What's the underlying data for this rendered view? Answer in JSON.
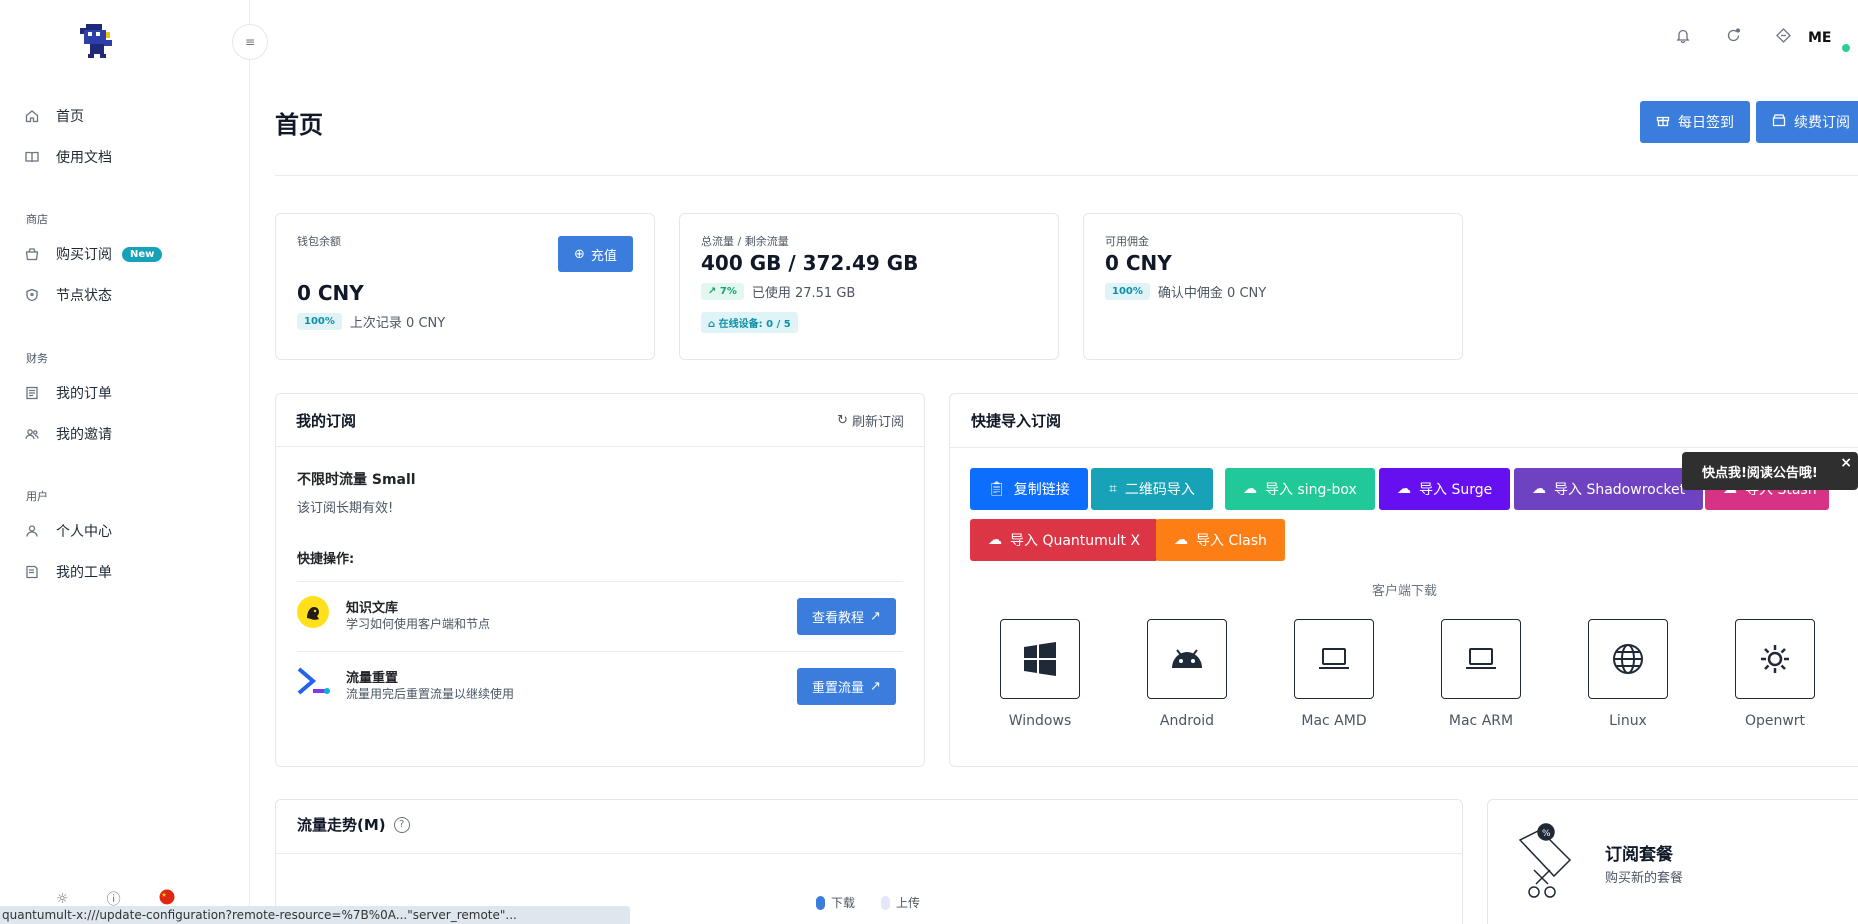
{
  "sidebar": {
    "items_main": [
      {
        "label": "首页",
        "icon": "home-icon"
      },
      {
        "label": "使用文档",
        "icon": "book-icon"
      }
    ],
    "section_shop": "商店",
    "items_shop": [
      {
        "label": "购买订阅",
        "icon": "shop-icon",
        "badge": "New"
      },
      {
        "label": "节点状态",
        "icon": "shield-icon"
      }
    ],
    "section_finance": "财务",
    "items_finance": [
      {
        "label": "我的订单",
        "icon": "receipt-icon"
      },
      {
        "label": "我的邀请",
        "icon": "users-icon"
      }
    ],
    "section_user": "用户",
    "items_user": [
      {
        "label": "个人中心",
        "icon": "user-icon"
      },
      {
        "label": "我的工单",
        "icon": "ticket-icon"
      }
    ]
  },
  "topbar": {
    "avatar_initials": "ME"
  },
  "page": {
    "title": "首页",
    "checkin_label": "每日签到",
    "renew_label": "续费订阅"
  },
  "stats": {
    "wallet": {
      "label": "钱包余额",
      "recharge_label": "充值",
      "value": "0 CNY",
      "pill": "100%",
      "note": "上次记录 0 CNY"
    },
    "traffic": {
      "label": "总流量 / 剩余流量",
      "value": "400 GB / 372.49 GB",
      "pill": "7%",
      "note": "已使用 27.51 GB",
      "devices": "在线设备: 0 / 5"
    },
    "commission": {
      "label": "可用佣金",
      "value": "0 CNY",
      "pill": "100%",
      "note": "确认中佣金 0 CNY"
    }
  },
  "subscription": {
    "title": "我的订阅",
    "refresh_label": "刷新订阅",
    "plan_name": "不限时流量 Small",
    "plan_note": "该订阅长期有效!",
    "quick_ops": "快捷操作:",
    "ops": [
      {
        "title": "知识文库",
        "desc": "学习如何使用客户端和节点",
        "button": "查看教程"
      },
      {
        "title": "流量重置",
        "desc": "流量用完后重置流量以继续使用",
        "button": "重置流量"
      }
    ]
  },
  "quick_import": {
    "title": "快捷导入订阅",
    "buttons": [
      {
        "label": "复制链接",
        "color": "#0d6efd"
      },
      {
        "label": "二维码导入",
        "color": "#17a2b8"
      },
      {
        "label": "导入 sing-box",
        "color": "#20c997"
      },
      {
        "label": "导入 Surge",
        "color": "#6610f2"
      },
      {
        "label": "导入 Shadowrocket",
        "color": "#6f42c1"
      },
      {
        "label": "导入 Stash",
        "color": "#d63384"
      },
      {
        "label": "导入 Quantumult X",
        "color": "#dc3545"
      },
      {
        "label": "导入 Clash",
        "color": "#fd7e14"
      }
    ],
    "client_header": "客户端下载",
    "clients": [
      "Windows",
      "Android",
      "Mac AMD",
      "Mac ARM",
      "Linux",
      "Openwrt"
    ]
  },
  "tooltip": {
    "text": "快点我!阅读公告哦!",
    "close": "×"
  },
  "trend": {
    "title": "流量走势(M)",
    "legend_download": "下载",
    "legend_upload": "上传"
  },
  "plans_card": {
    "title": "订阅套餐",
    "subtitle": "购买新的套餐"
  },
  "status_bar": {
    "url": "quantumult-x:///update-configuration?remote-resource=%7B%0A...\"server_remote\"..."
  }
}
